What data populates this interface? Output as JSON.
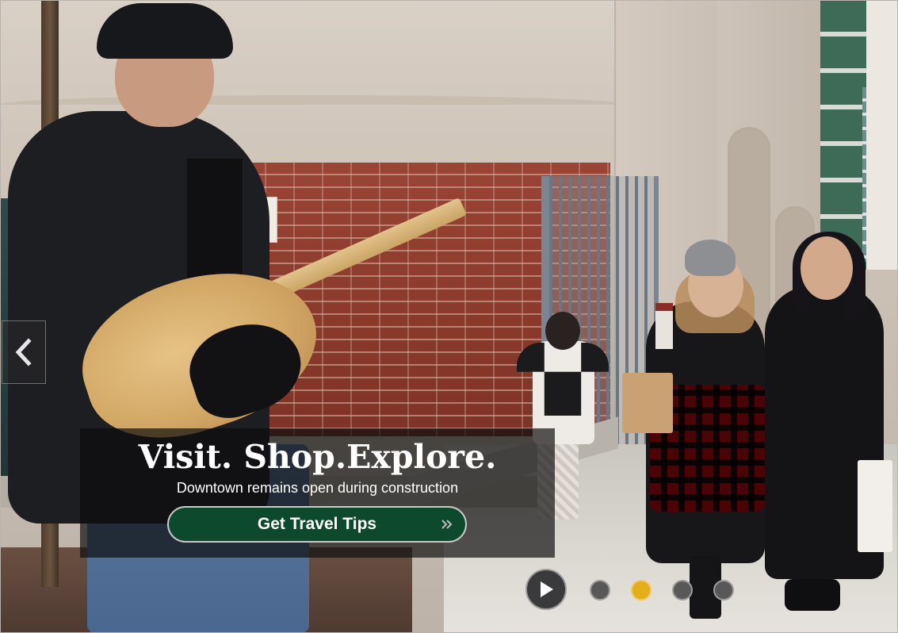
{
  "hero": {
    "image_alt": "Musician playing guitar and shoppers walking on a downtown sidewalk",
    "headline": "Visit. Shop.Explore.",
    "subheadline": "Downtown remains open during construction",
    "cta_label": "Get Travel Tips",
    "accent_color": "#0d4a2d",
    "active_dot_color": "#e4ad1a"
  },
  "carousel": {
    "prev_icon": "chevron-left-icon",
    "play_icon": "play-icon",
    "slides_count": 4,
    "active_index": 1
  }
}
